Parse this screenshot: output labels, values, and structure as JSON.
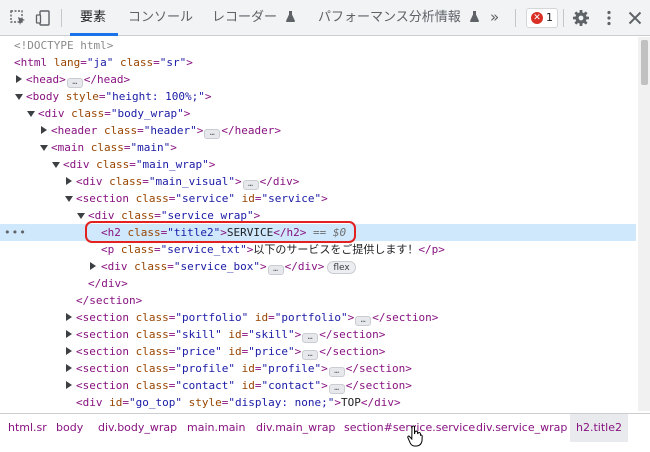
{
  "toolbar": {
    "tabs": [
      {
        "label": "要素",
        "flask": false
      },
      {
        "label": "コンソール",
        "flask": false
      },
      {
        "label": "レコーダー",
        "flask": true
      },
      {
        "label": "パフォーマンス分析情報",
        "flask": true
      }
    ],
    "overflow": "»",
    "error_count": "1",
    "accent": "#1a73e8"
  },
  "tree": {
    "doctype": "<!DOCTYPE html>",
    "html_lang": "\"ja\"",
    "html_class": "\"sr\"",
    "body_style": "\"height: 100%;\"",
    "body_wrap": "\"body_wrap\"",
    "header_class": "\"header\"",
    "main_class": "\"main\"",
    "main_wrap": "\"main_wrap\"",
    "main_visual": "\"main_visual\"",
    "section_service_class": "\"service\"",
    "section_service_id": "\"service\"",
    "service_wrap": "\"service_wrap\"",
    "h2_class": "\"title2\"",
    "h2_text": "SERVICE",
    "selected_marker": "== $0",
    "p_class": "\"service_txt\"",
    "p_text": "以下のサービスをご提供します！",
    "service_box": "\"service_box\"",
    "flex_badge": "flex",
    "sections": [
      {
        "cls": "\"portfolio\"",
        "id": "\"portfolio\""
      },
      {
        "cls": "\"skill\"",
        "id": "\"skill\""
      },
      {
        "cls": "\"price\"",
        "id": "\"price\""
      },
      {
        "cls": "\"profile\"",
        "id": "\"profile\""
      },
      {
        "cls": "\"contact\"",
        "id": "\"contact\""
      }
    ],
    "go_top_id": "\"go_top\"",
    "go_top_style": "\"display: none;\"",
    "go_top_text": "TOP"
  },
  "breadcrumbs": [
    "html.sr",
    "body",
    "div.body_wrap",
    "main.main",
    "div.main_wrap",
    "section#service.service",
    "div.service_wrap",
    "h2.title2"
  ],
  "highlight_color": "#e32121"
}
